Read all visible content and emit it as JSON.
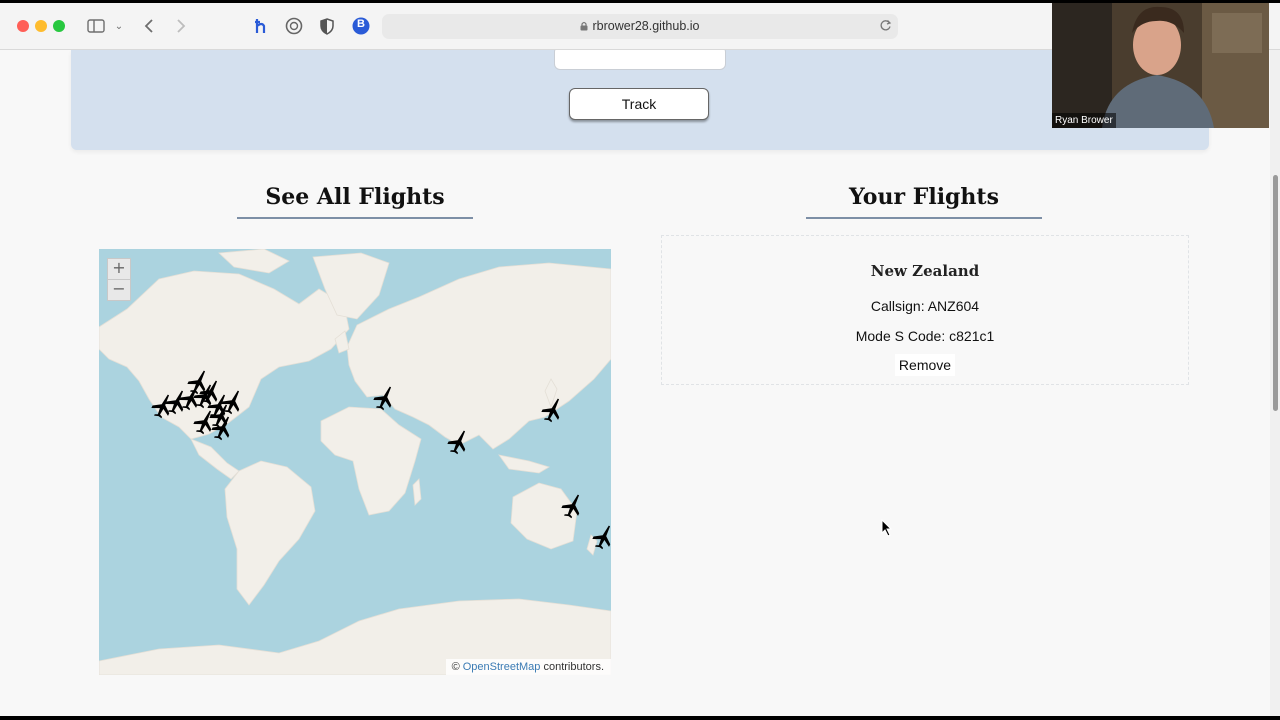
{
  "browser": {
    "url": "rbrower28.github.io",
    "traffic_colors": [
      "#ff5f57",
      "#febc2e",
      "#28c840"
    ],
    "extension_badge": "B"
  },
  "hero": {
    "track_label": "Track"
  },
  "sections": {
    "all_flights_title": "See All Flights",
    "your_flights_title": "Your Flights"
  },
  "map": {
    "zoom_in": "+",
    "zoom_out": "−",
    "attribution_prefix": "©",
    "attribution_link": "OpenStreetMap",
    "attribution_suffix": "contributors."
  },
  "flight_card": {
    "country": "New Zealand",
    "callsign": "Callsign: ANZ604",
    "mode_s": "Mode S Code: c821c1",
    "remove_label": "Remove"
  },
  "webcam": {
    "name": "Ryan Brower"
  },
  "colors": {
    "hero_bg": "#d4e0ee",
    "ocean": "#abd3df",
    "land": "#f2efe9"
  }
}
